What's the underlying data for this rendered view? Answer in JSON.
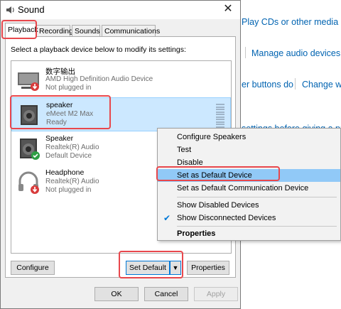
{
  "background": {
    "links": [
      "Play CDs or other media auto",
      "Manage audio devices",
      "er buttons do",
      "Change wh",
      "settings before giving a pre"
    ]
  },
  "dialog": {
    "title": "Sound",
    "close_glyph": "✕",
    "tabs": [
      "Playback",
      "Recording",
      "Sounds",
      "Communications"
    ],
    "instruction": "Select a playback device below to modify its settings:",
    "devices": [
      {
        "name": "数字输出",
        "desc": "AMD High Definition Audio Device",
        "status": "Not plugged in",
        "icon": "monitor-icon",
        "badge": "unplugged-badge"
      },
      {
        "name": "speaker",
        "desc": "eMeet M2 Max",
        "status": "Ready",
        "icon": "speaker-icon",
        "selected": true
      },
      {
        "name": "Speaker",
        "desc": "Realtek(R) Audio",
        "status": "Default Device",
        "icon": "speaker-icon",
        "badge": "default-check-badge"
      },
      {
        "name": "Headphone",
        "desc": "Realtek(R) Audio",
        "status": "Not plugged in",
        "icon": "headphone-icon",
        "badge": "unplugged-badge"
      }
    ],
    "buttons": {
      "configure": "Configure",
      "set_default": "Set Default",
      "dropdown_glyph": "▼",
      "properties": "Properties",
      "ok": "OK",
      "cancel": "Cancel",
      "apply": "Apply"
    }
  },
  "context_menu": {
    "items": [
      {
        "label": "Configure Speakers"
      },
      {
        "label": "Test"
      },
      {
        "label": "Disable"
      },
      {
        "label": "Set as Default Device",
        "highlighted": true
      },
      {
        "label": "Set as Default Communication Device"
      },
      {
        "label": "Show Disabled Devices",
        "checked": false
      },
      {
        "label": "Show Disconnected Devices",
        "checked": true
      },
      {
        "label": "Properties",
        "bold": true
      }
    ],
    "check_glyph": "✔"
  },
  "colors": {
    "highlight_box": "#e8474c",
    "selection": "#cce8ff",
    "menu_hover": "#91c9f7",
    "link": "#0063b1"
  }
}
